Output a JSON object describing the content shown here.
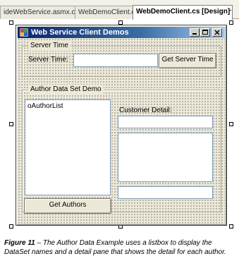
{
  "ide": {
    "tabs": [
      {
        "label": "ideWebService.asmx.cs",
        "active": false
      },
      {
        "label": "WebDemoClient.cs",
        "active": false
      },
      {
        "label": "WebDemoClient.cs [Design]",
        "active": true
      }
    ]
  },
  "form": {
    "title": "Web Service Client Demos",
    "caption_buttons": [
      "minimize",
      "maximize",
      "close"
    ],
    "server_time_group": {
      "title": "Server Time",
      "label": "Server Time:",
      "value": "",
      "button_label": "Get Server Time"
    },
    "author_group": {
      "title": "Author Data Set Demo",
      "listbox_items": [
        "oAuthorList"
      ],
      "customer_detail_label": "Customer Detail:",
      "get_authors_label": "Get Authors"
    }
  },
  "caption": {
    "figure": "Figure 11",
    "text": " – The Author Data Example uses a listbox to display the DataSet names and a detail pane that shows the detail for each author."
  },
  "colors": {
    "titlebar_start": "#0a246a",
    "titlebar_end": "#a6caf0",
    "form_bg": "#ece9d8"
  }
}
